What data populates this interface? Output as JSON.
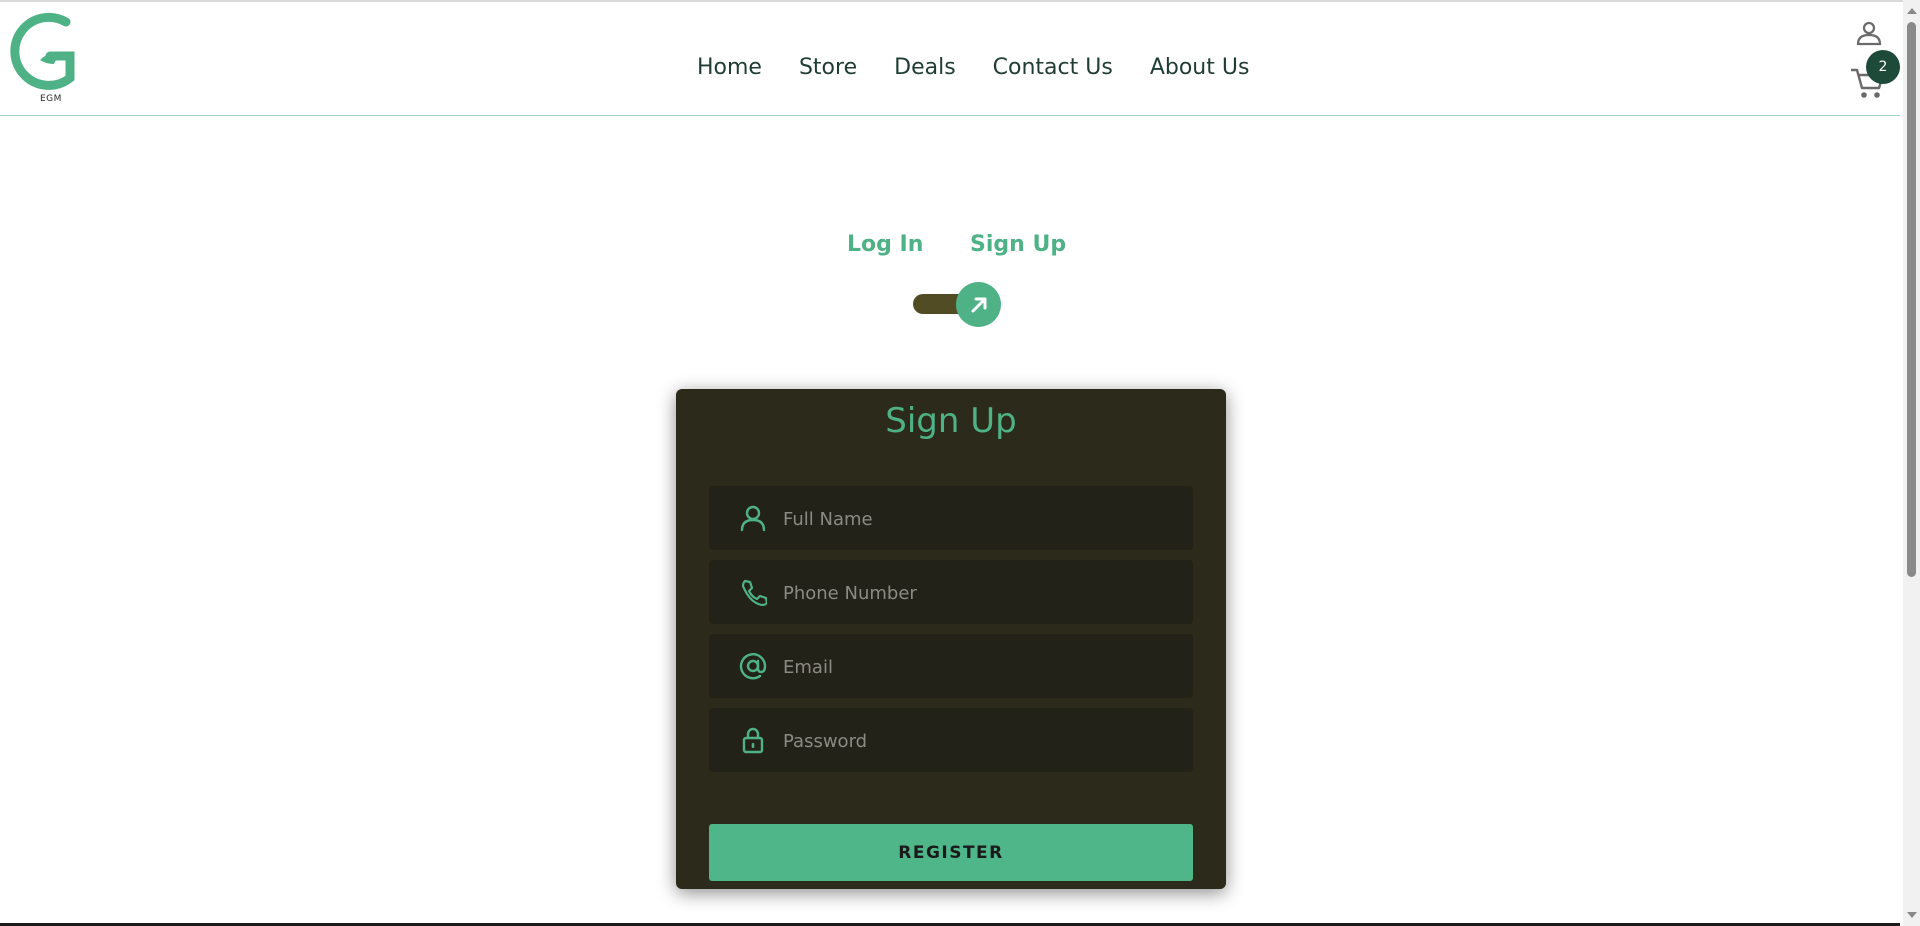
{
  "header": {
    "logo_text": "EGM",
    "nav": [
      "Home",
      "Store",
      "Deals",
      "Contact Us",
      "About Us"
    ],
    "cart_count": "2"
  },
  "auth": {
    "tab_login": "Log In",
    "tab_signup": "Sign Up",
    "form_title": "Sign Up",
    "fields": {
      "full_name_placeholder": "Full Name",
      "phone_placeholder": "Phone Number",
      "email_placeholder": "Email",
      "password_placeholder": "Password"
    },
    "register_label": "REGISTER"
  },
  "colors": {
    "brand_green": "#4fb286",
    "card_bg": "#2b2a1b",
    "toggle_track": "#524c24",
    "badge_bg": "#1e4a3a"
  }
}
